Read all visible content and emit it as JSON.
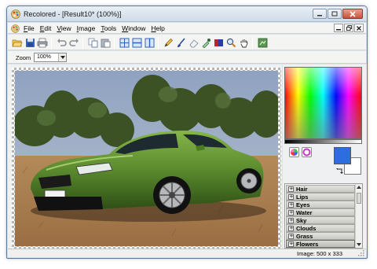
{
  "window": {
    "title": "Recolored - [Result10* (100%)]",
    "icon": "palette-app-icon"
  },
  "menu": {
    "items": [
      "File",
      "Edit",
      "View",
      "Image",
      "Tools",
      "Window",
      "Help"
    ]
  },
  "toolbar": {
    "icons": [
      "open-folder-icon",
      "save-icon",
      "print-icon",
      "undo-icon",
      "redo-icon",
      "copy-icon",
      "paste-icon",
      "tile-view-icon",
      "horizontal-split-icon",
      "vertical-split-icon",
      "pencil-icon",
      "brush-icon",
      "eraser-icon",
      "dropper-icon",
      "palette-swatch-icon",
      "zoom-icon",
      "hand-icon",
      "export-icon"
    ]
  },
  "zoom": {
    "label": "Zoom",
    "value": "100%"
  },
  "colors": {
    "primary": "#2d6de0",
    "secondary": "#ffffff",
    "car_body": "#5a8a2e"
  },
  "categories": {
    "items": [
      "Hair",
      "Lips",
      "Eyes",
      "Water",
      "Sky",
      "Clouds",
      "Grass",
      "Flowers"
    ],
    "selected": "Flowers"
  },
  "status": {
    "text": "Image: 500 x 333"
  }
}
